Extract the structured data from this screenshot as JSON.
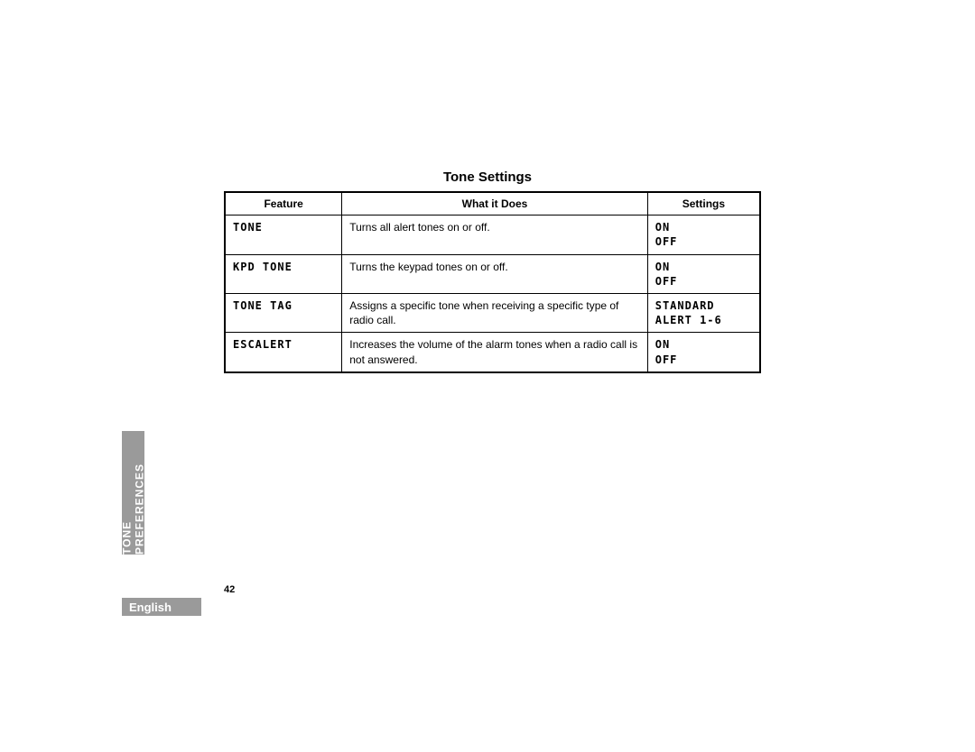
{
  "title": "Tone Settings",
  "headers": {
    "feature": "Feature",
    "what": "What it Does",
    "settings": "Settings"
  },
  "rows": [
    {
      "feature": "TONE",
      "what": "Turns all alert tones on or off.",
      "settings": "ON\nOFF"
    },
    {
      "feature": "KPD TONE",
      "what": "Turns the keypad tones on or off.",
      "settings": "ON\nOFF"
    },
    {
      "feature": "TONE TAG",
      "what": "Assigns a specific tone when receiving a specific type of radio call.",
      "settings": "STANDARD\nALERT 1-6"
    },
    {
      "feature": "ESCALERT",
      "what": "Increases the volume of the alarm tones when a radio call is not answered.",
      "settings": "ON\nOFF"
    }
  ],
  "side_tab": "TONE PREFERENCES",
  "page_number": "42",
  "language": "English"
}
